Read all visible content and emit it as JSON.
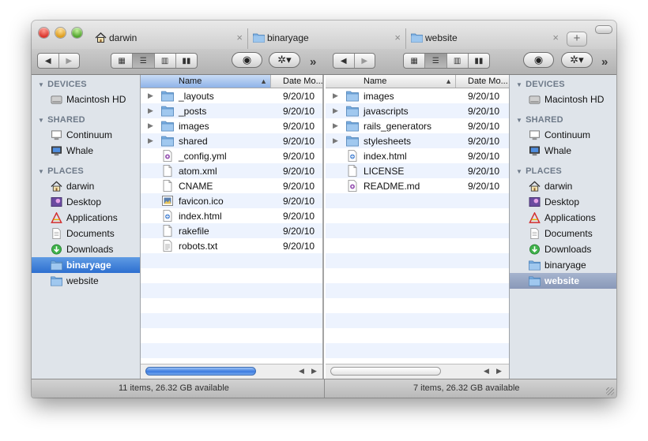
{
  "tabs": [
    {
      "label": "darwin",
      "icon": "home-icon",
      "close": "×"
    },
    {
      "label": "binaryage",
      "icon": "folder-icon",
      "close": "×"
    },
    {
      "label": "website",
      "icon": "folder-icon",
      "close": "×"
    }
  ],
  "tab_add_label": "+",
  "toolbar": {
    "back": "◀",
    "forward": "▶",
    "chevrons": "»"
  },
  "sidebar": {
    "devices_title": "DEVICES",
    "shared_title": "SHARED",
    "places_title": "PLACES",
    "devices": [
      "Macintosh HD"
    ],
    "shared": [
      "Continuum",
      "Whale"
    ],
    "places": [
      "darwin",
      "Desktop",
      "Applications",
      "Documents",
      "Downloads",
      "binaryage",
      "website"
    ],
    "left_selected": "binaryage",
    "right_selected": "website"
  },
  "columns": {
    "name": "Name",
    "date": "Date Mo..."
  },
  "left_pane": {
    "rows": [
      {
        "name": "_layouts",
        "date": "9/20/10",
        "kind": "folder"
      },
      {
        "name": "_posts",
        "date": "9/20/10",
        "kind": "folder"
      },
      {
        "name": "images",
        "date": "9/20/10",
        "kind": "folder"
      },
      {
        "name": "shared",
        "date": "9/20/10",
        "kind": "folder"
      },
      {
        "name": "_config.yml",
        "date": "9/20/10",
        "kind": "script"
      },
      {
        "name": "atom.xml",
        "date": "9/20/10",
        "kind": "file"
      },
      {
        "name": "CNAME",
        "date": "9/20/10",
        "kind": "file"
      },
      {
        "name": "favicon.ico",
        "date": "9/20/10",
        "kind": "image"
      },
      {
        "name": "index.html",
        "date": "9/20/10",
        "kind": "html"
      },
      {
        "name": "rakefile",
        "date": "9/20/10",
        "kind": "file"
      },
      {
        "name": "robots.txt",
        "date": "9/20/10",
        "kind": "text"
      }
    ]
  },
  "right_pane": {
    "rows": [
      {
        "name": "images",
        "date": "9/20/10",
        "kind": "folder"
      },
      {
        "name": "javascripts",
        "date": "9/20/10",
        "kind": "folder"
      },
      {
        "name": "rails_generators",
        "date": "9/20/10",
        "kind": "folder"
      },
      {
        "name": "stylesheets",
        "date": "9/20/10",
        "kind": "folder"
      },
      {
        "name": "index.html",
        "date": "9/20/10",
        "kind": "html"
      },
      {
        "name": "LICENSE",
        "date": "9/20/10",
        "kind": "file"
      },
      {
        "name": "README.md",
        "date": "9/20/10",
        "kind": "script"
      }
    ]
  },
  "status": {
    "left": "11 items, 26.32 GB available",
    "right": "7 items, 26.32 GB available"
  },
  "colors": {
    "selection": "#3b7be0",
    "sidebar_bg": "#dfe4ea",
    "row_alt": "#edf3fe"
  }
}
